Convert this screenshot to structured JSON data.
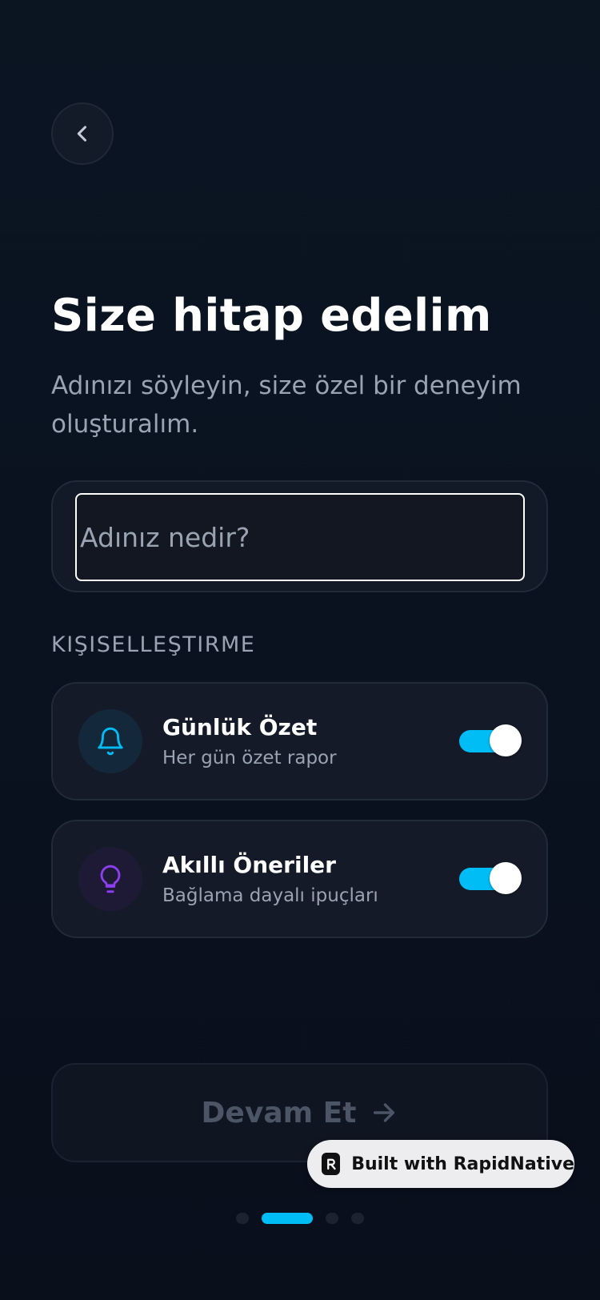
{
  "header": {
    "back_icon": "chevron-left-icon"
  },
  "intro": {
    "title": "Size hitap edelim",
    "subtitle": "Adınızı söyleyin, size özel bir deneyim oluşturalım."
  },
  "name_input": {
    "value": "",
    "placeholder": "Adınız nedir?"
  },
  "personalization": {
    "section_label": "KIŞISELLEŞTIRME",
    "options": [
      {
        "title": "Günlük Özet",
        "description": "Her gün özet rapor",
        "icon": "bell-icon",
        "enabled": true,
        "accent": "#00bdf5"
      },
      {
        "title": "Akıllı Öneriler",
        "description": "Bağlama dayalı ipuçları",
        "icon": "lightbulb-icon",
        "enabled": true,
        "accent": "#8b3ff0"
      }
    ]
  },
  "footer": {
    "continue_label": "Devam Et",
    "continue_icon": "arrow-right-icon",
    "badge_text": "Built with RapidNative"
  },
  "pagination": {
    "total": 4,
    "active_index": 1
  },
  "colors": {
    "accent": "#00bdf5",
    "background": "#0a1220",
    "card": "#141a27"
  }
}
